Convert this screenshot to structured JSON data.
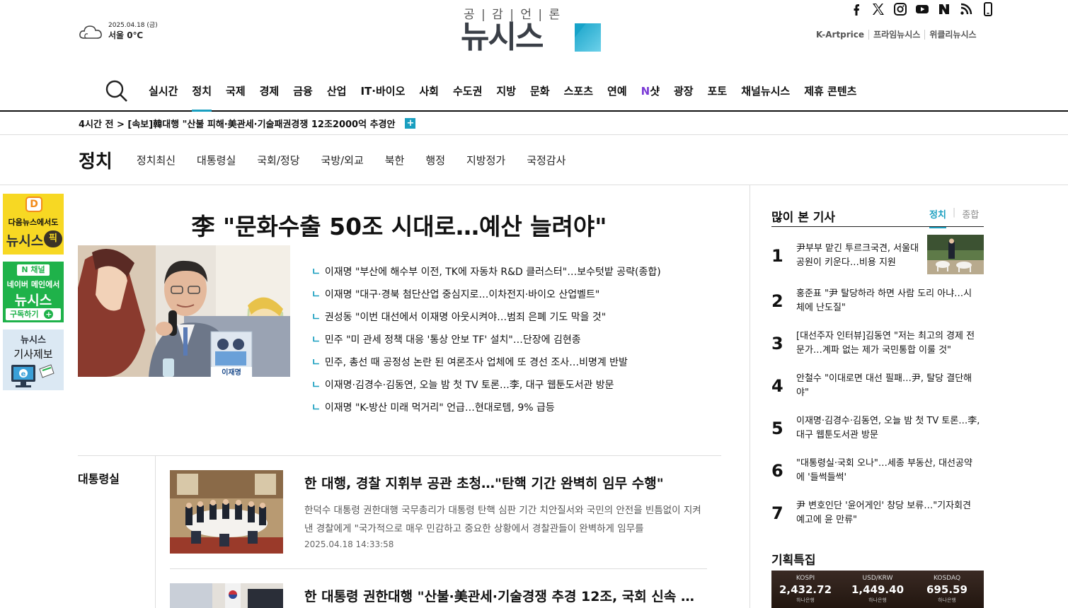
{
  "header": {
    "weather": {
      "date": "2025.04.18 (금)",
      "temp": "서울 0℃",
      "icon": "cloud-icon"
    },
    "logo": {
      "slogan": "공 | 감 | 언 | 론",
      "wordmark": "뉴시스"
    },
    "social": [
      "facebook-icon",
      "x-icon",
      "instagram-icon",
      "youtube-icon",
      "naver-icon",
      "rss-icon",
      "mobile-icon"
    ],
    "partners": [
      "K-Artprice",
      "프라임뉴시스",
      "위클리뉴시스"
    ]
  },
  "nav": {
    "items": [
      "실시간",
      "정치",
      "국제",
      "경제",
      "금융",
      "산업",
      "IT·바이오",
      "사회",
      "수도권",
      "지방",
      "문화",
      "스포츠",
      "연예",
      "N샷",
      "광장",
      "포토",
      "채널뉴시스",
      "제휴 콘텐츠"
    ],
    "active": "정치"
  },
  "breaking": {
    "text": "4시간 전 > [속보]韓대행 \"산불 피해·美관세·기술패권경쟁 12조2000억 추경안",
    "plus": "+"
  },
  "subnav": {
    "title": "정치",
    "items": [
      "정치최신",
      "대통령실",
      "국회/정당",
      "국방/외교",
      "북한",
      "행정",
      "지방정가",
      "국정감사"
    ]
  },
  "banners": {
    "b1": {
      "line1": "다음뉴스에서도",
      "line2": "뉴시스",
      "line3": "픽"
    },
    "b2": {
      "line1": "N 채널",
      "line2": "네이버 메인에서",
      "line3": "뉴시스",
      "line4": "구독하기"
    },
    "b3": {
      "line1": "뉴시스",
      "line2": "기사제보"
    }
  },
  "headline": {
    "title": "李 \"문화수출 50조 시대로…예산 늘려야\"",
    "related": [
      "이재명 \"부산에 해수부 이전, TK에 자동차 R&D 클러스터\"…보수텃밭 공략(종합)",
      "이재명 \"대구·경북 첨단산업 중심지로…이차전지·바이오 산업벨트\"",
      "권성동 \"이번 대선에서 이재명 아웃시켜야…범죄 은폐 기도 막을 것\"",
      "민주 \"미 관세 정책 대응 '통상 안보 TF' 설치\"…단장에 김현종",
      "민주, 총선 때 공정성 논란 된 여론조사 업체에 또 경선 조사…비명계 반발",
      "이재명·김경수·김동연, 오늘 밤 첫 TV 토론…李, 대구 웹툰도서관 방문",
      "이재명 \"K-방산 미래 먹거리\" 언급…현대로템, 9% 급등"
    ],
    "related_mark": "ㄴ",
    "photo_sign": "이재명"
  },
  "section": {
    "label": "대통령실",
    "articles": [
      {
        "title": "한 대행, 경찰 지휘부 공관 초청…\"탄핵 기간 완벽히 임무 수행\"",
        "summary": "한덕수 대통령 권한대행 국무총리가 대통령 탄핵 심판 기간 치안질서와 국민의 안전을 빈틈없이 지켜낸 경찰에게 \"국가적으로 매우 민감하고 중요한 상황에서 경찰관들이 완벽하게 임무를",
        "date": "2025.04.18 14:33:58"
      },
      {
        "title": "한 대통령 권한대행 \"산불·美관세·기술경쟁 추경 12조, 국회 신속 …",
        "summary": "",
        "date": ""
      }
    ]
  },
  "sidebar": {
    "popular_title": "많이 본 기사",
    "tabs": [
      "정치",
      "종합"
    ],
    "popular": [
      {
        "rank": "1",
        "text": "尹부부 맡긴 투르크국견, 서울대공원이 키운다…비용 지원"
      },
      {
        "rank": "2",
        "text": "홍준표 \"尹 탈당하라 하면 사람 도리 아냐…시체에 난도질\""
      },
      {
        "rank": "3",
        "text": "[대선주자 인터뷰]김동연 \"저는 최고의 경제 전문가…계파 없는 제가 국민통합 이룰 것\""
      },
      {
        "rank": "4",
        "text": "안철수 \"이대로면 대선 필패…尹, 탈당 결단해야\""
      },
      {
        "rank": "5",
        "text": "이재명·김경수·김동연, 오늘 밤 첫 TV 토론…李, 대구 웹툰도서관 방문"
      },
      {
        "rank": "6",
        "text": "\"대통령실·국회 오나\"…세종 부동산, 대선공약에 '들썩들썩'"
      },
      {
        "rank": "7",
        "text": "尹 변호인단 '윤어게인' 창당 보류…\"기자회견 예고에 윤 만류\""
      }
    ],
    "special_title": "기획특집",
    "market": [
      {
        "name": "KOSPI",
        "value": "2,432.72",
        "bank": "하나은행"
      },
      {
        "name": "USD/KRW",
        "value": "1,449.40",
        "bank": "하나은행"
      },
      {
        "name": "KOSDAQ",
        "value": "695.59",
        "bank": "하나은행"
      }
    ]
  },
  "colors": {
    "accent": "#1a9fc0",
    "nshot": "#7b3bd6",
    "naver_green": "#1fb24a",
    "daum_yellow": "#f7d823"
  }
}
